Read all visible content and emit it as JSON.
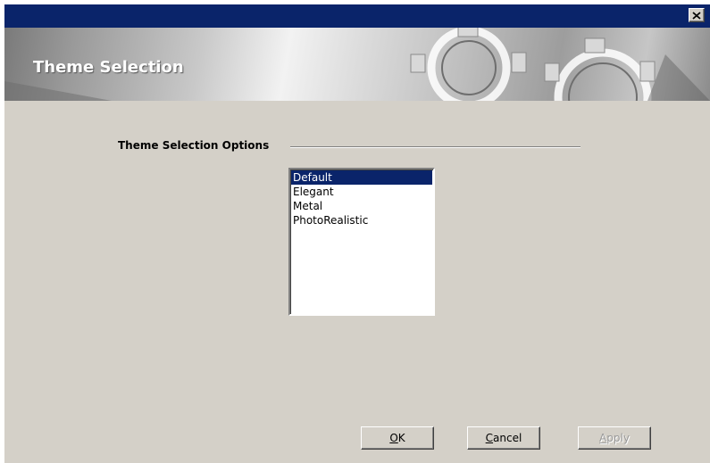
{
  "window": {
    "close_icon": "close-icon",
    "titlebar_color": "#0a246a",
    "face_color": "#d4d0c8"
  },
  "banner": {
    "title": "Theme Selection",
    "decoration_icon": "gears-icon"
  },
  "options": {
    "section_label": "Theme Selection Options",
    "themes": [
      "Default",
      "Elegant",
      "Metal",
      "PhotoRealistic"
    ],
    "selected": "Default"
  },
  "buttons": {
    "ok": {
      "accel": "O",
      "rest": "K"
    },
    "cancel": {
      "accel": "C",
      "rest": "ancel"
    },
    "apply": {
      "accel": "A",
      "rest": "pply",
      "disabled": true
    }
  }
}
